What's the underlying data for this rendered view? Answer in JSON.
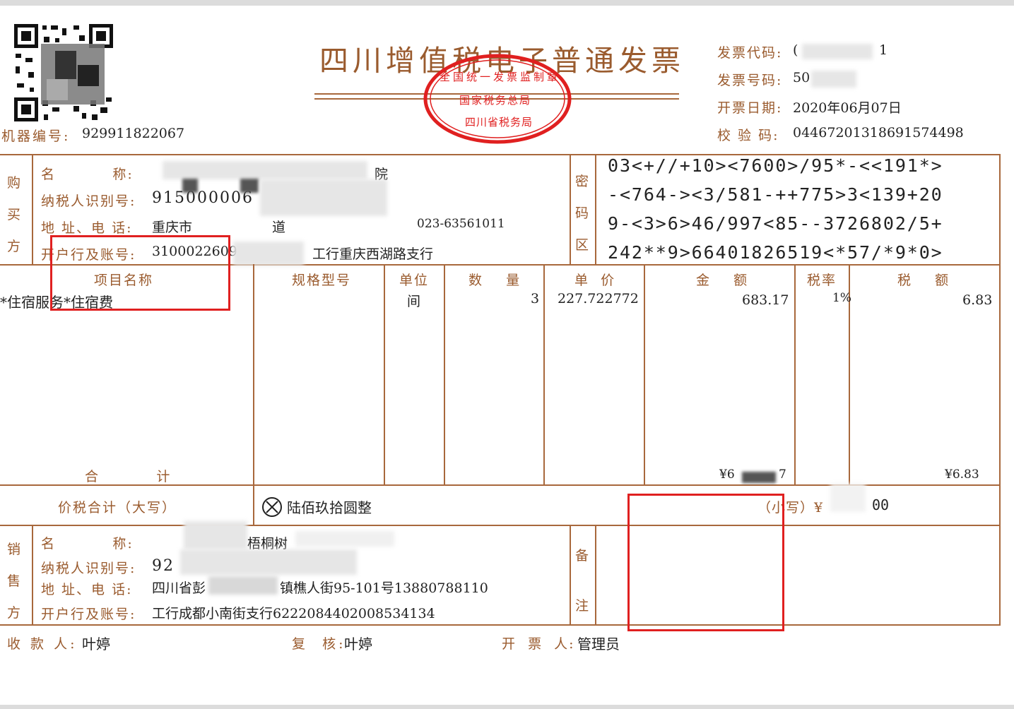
{
  "title": "四川增值税电子普通发票",
  "seal": {
    "top_text": "全国统一发票监制章",
    "middle_text": "国家税务总局",
    "bottom_text": "四川省税务局",
    "color": "#e02020"
  },
  "machine": {
    "label": "机器编号:",
    "value": "929911822067"
  },
  "meta": {
    "code_label": "发票代码:",
    "code_value": "(",
    "code_tail": "1",
    "number_label": "发票号码:",
    "number_value": "50",
    "date_label": "开票日期:",
    "date_value": "2020年06月07日",
    "check_label": "校 验 码:",
    "check_value": "04467201318691574498"
  },
  "buyer": {
    "side_label": [
      "购",
      "买",
      "方"
    ],
    "name_label": "名          称:",
    "name_value": "院",
    "tax_label": "纳税人识别号:",
    "tax_value": "915000006",
    "addr_label": "地 址、电 话:",
    "addr_value": "重庆市",
    "addr_mid": "道",
    "addr_phone": "023-63561011",
    "bank_label": "开户行及账号:",
    "bank_value": "3100022609",
    "bank_name": "工行重庆西湖路支行"
  },
  "cipher": {
    "side_label": [
      "密",
      "码",
      "区"
    ],
    "lines": [
      "03<+//+10><7600>/95*-<<191*>",
      "-<764-><3/581-++775>3<139+20",
      "9-<3>6>46/997<85--3726802/5+",
      "242**9>66401826519<*57/*9*0>"
    ]
  },
  "items": {
    "headers": [
      "项目名称",
      "规格型号",
      "单位",
      "数    量",
      "单  价",
      "金    额",
      "税率",
      "税    额"
    ],
    "rows": [
      {
        "name": "*住宿服务*住宿费",
        "spec": "",
        "unit": "间",
        "qty": "3",
        "price": "227.722772",
        "amount": "683.17",
        "rate": "1%",
        "tax": "6.83"
      }
    ],
    "total_label": "合          计",
    "total_amount": "¥6",
    "total_amount_tail": "7",
    "total_tax": "¥6.83"
  },
  "sum": {
    "label": "价税合计（大写）",
    "words": "陆佰玖拾圆整",
    "small_label": "（小写）¥",
    "small_value": "00"
  },
  "seller": {
    "side_label": [
      "销",
      "售",
      "方"
    ],
    "name_label": "名          称:",
    "name_value": "梧桐树",
    "tax_label": "纳税人识别号:",
    "tax_value": "92",
    "addr_label": "地 址、电 话:",
    "addr_value": "四川省彭",
    "addr_tail": "镇樵人街95-101号13880788110",
    "bank_label": "开户行及账号:",
    "bank_value": "工行成都小南街支行6222084402008534134"
  },
  "remark": {
    "side_label": [
      "备",
      "注"
    ]
  },
  "footer": {
    "payee_label": "收 款 人:",
    "payee_value": "叶婷",
    "review_label": "复  核:",
    "review_value": "叶婷",
    "issuer_label": "开  票  人:",
    "issuer_value": "管理员"
  }
}
